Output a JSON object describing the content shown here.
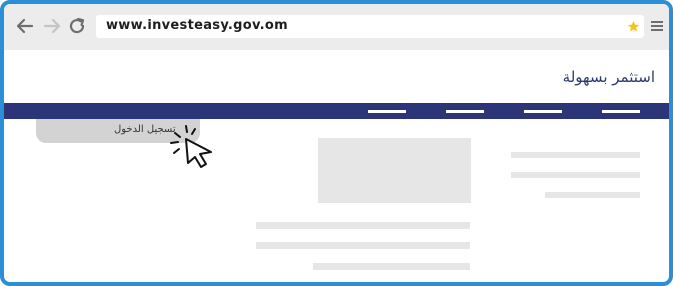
{
  "browser": {
    "url": "www.investeasy.gov.om",
    "icons": {
      "back": "arrow-left-icon",
      "forward": "arrow-right-icon",
      "reload": "reload-icon",
      "bookmark": "star-icon",
      "menu": "hamburger-menu-icon"
    },
    "colors": {
      "frame": "#2a8fd6",
      "toolbar": "#ececec",
      "star": "#f5c518"
    }
  },
  "site": {
    "title": "استثمر بسهولة",
    "nav_item_count": 4,
    "login_label": "تسجيل الدخول",
    "colors": {
      "navbar": "#2b3578",
      "title": "#2b3a6e",
      "login_tab": "#d3d3d3",
      "placeholder": "#e6e6e6"
    },
    "cursor": "pointer-click-icon"
  }
}
